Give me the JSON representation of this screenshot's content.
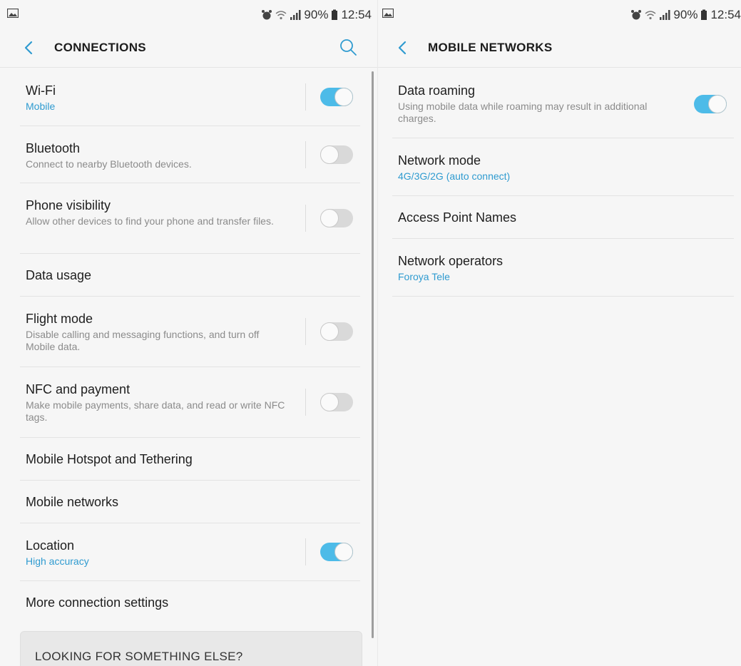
{
  "status_bar": {
    "battery": "90%",
    "time": "12:54"
  },
  "left": {
    "title": "CONNECTIONS",
    "items": [
      {
        "title": "Wi-Fi",
        "subtitle": "Mobile",
        "subtitle_style": "accent",
        "toggle": "on"
      },
      {
        "title": "Bluetooth",
        "subtitle": "Connect to nearby Bluetooth devices.",
        "toggle": "off"
      },
      {
        "title": "Phone visibility",
        "subtitle": "Allow other devices to find your phone and transfer files.",
        "toggle": "off"
      },
      {
        "title": "Data usage"
      },
      {
        "title": "Flight mode",
        "subtitle": "Disable calling and messaging functions, and turn off Mobile data.",
        "toggle": "off"
      },
      {
        "title": "NFC and payment",
        "subtitle": "Make mobile payments, share data, and read or write NFC tags.",
        "toggle": "off"
      },
      {
        "title": "Mobile Hotspot and Tethering"
      },
      {
        "title": "Mobile networks"
      },
      {
        "title": "Location",
        "subtitle": "High accuracy",
        "subtitle_style": "accent",
        "toggle": "on"
      },
      {
        "title": "More connection settings"
      }
    ],
    "card_title": "LOOKING FOR SOMETHING ELSE?"
  },
  "right": {
    "title": "MOBILE NETWORKS",
    "items": [
      {
        "title": "Data roaming",
        "subtitle": "Using mobile data while roaming may result in additional charges.",
        "toggle": "on"
      },
      {
        "title": "Network mode",
        "subtitle": "4G/3G/2G (auto connect)",
        "subtitle_style": "accent"
      },
      {
        "title": "Access Point Names"
      },
      {
        "title": "Network operators",
        "subtitle": "Foroya Tele",
        "subtitle_style": "accent"
      }
    ]
  },
  "colors": {
    "accent": "#2f9bd0",
    "toggle_on": "#4dbbe8",
    "toggle_off": "#d9d9d9",
    "background": "#f6f6f6"
  }
}
